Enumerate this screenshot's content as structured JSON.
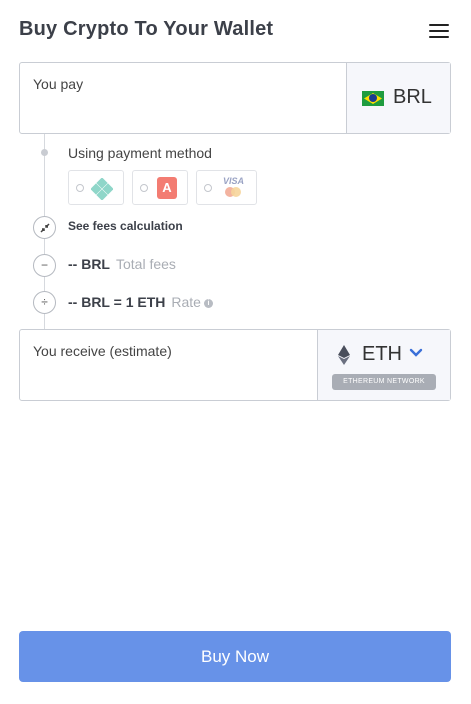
{
  "header": {
    "title": "Buy Crypto To Your Wallet",
    "menu_icon": "hamburger-menu-icon"
  },
  "pay": {
    "label": "You pay",
    "amount": "",
    "currency": "BRL",
    "flag_icon": "brazil-flag-icon"
  },
  "payment_method": {
    "label": "Using payment method",
    "options": [
      {
        "name": "pix",
        "icon": "pix-logo-icon",
        "selected": false
      },
      {
        "name": "astropay",
        "icon": "astropay-logo-icon",
        "glyph": "A",
        "selected": false
      },
      {
        "name": "card",
        "icon": "visa-mastercard-icon",
        "brand_text": "VISA",
        "selected": false
      }
    ]
  },
  "fees": {
    "link_label": "See fees calculation",
    "total_value": "-- BRL",
    "total_label": "Total fees",
    "rate_value": "-- BRL = 1 ETH",
    "rate_label": "Rate",
    "minus_glyph": "−",
    "divide_glyph": "÷",
    "info_glyph": "i"
  },
  "receive": {
    "label": "You receive (estimate)",
    "amount": "",
    "currency": "ETH",
    "network": "ETHEREUM NETWORK"
  },
  "buy_button": {
    "label": "Buy Now"
  },
  "colors": {
    "accent": "#6792e8",
    "title": "#3c4049",
    "border": "#c9cdd4",
    "currency_bg": "#f6f7fb"
  }
}
